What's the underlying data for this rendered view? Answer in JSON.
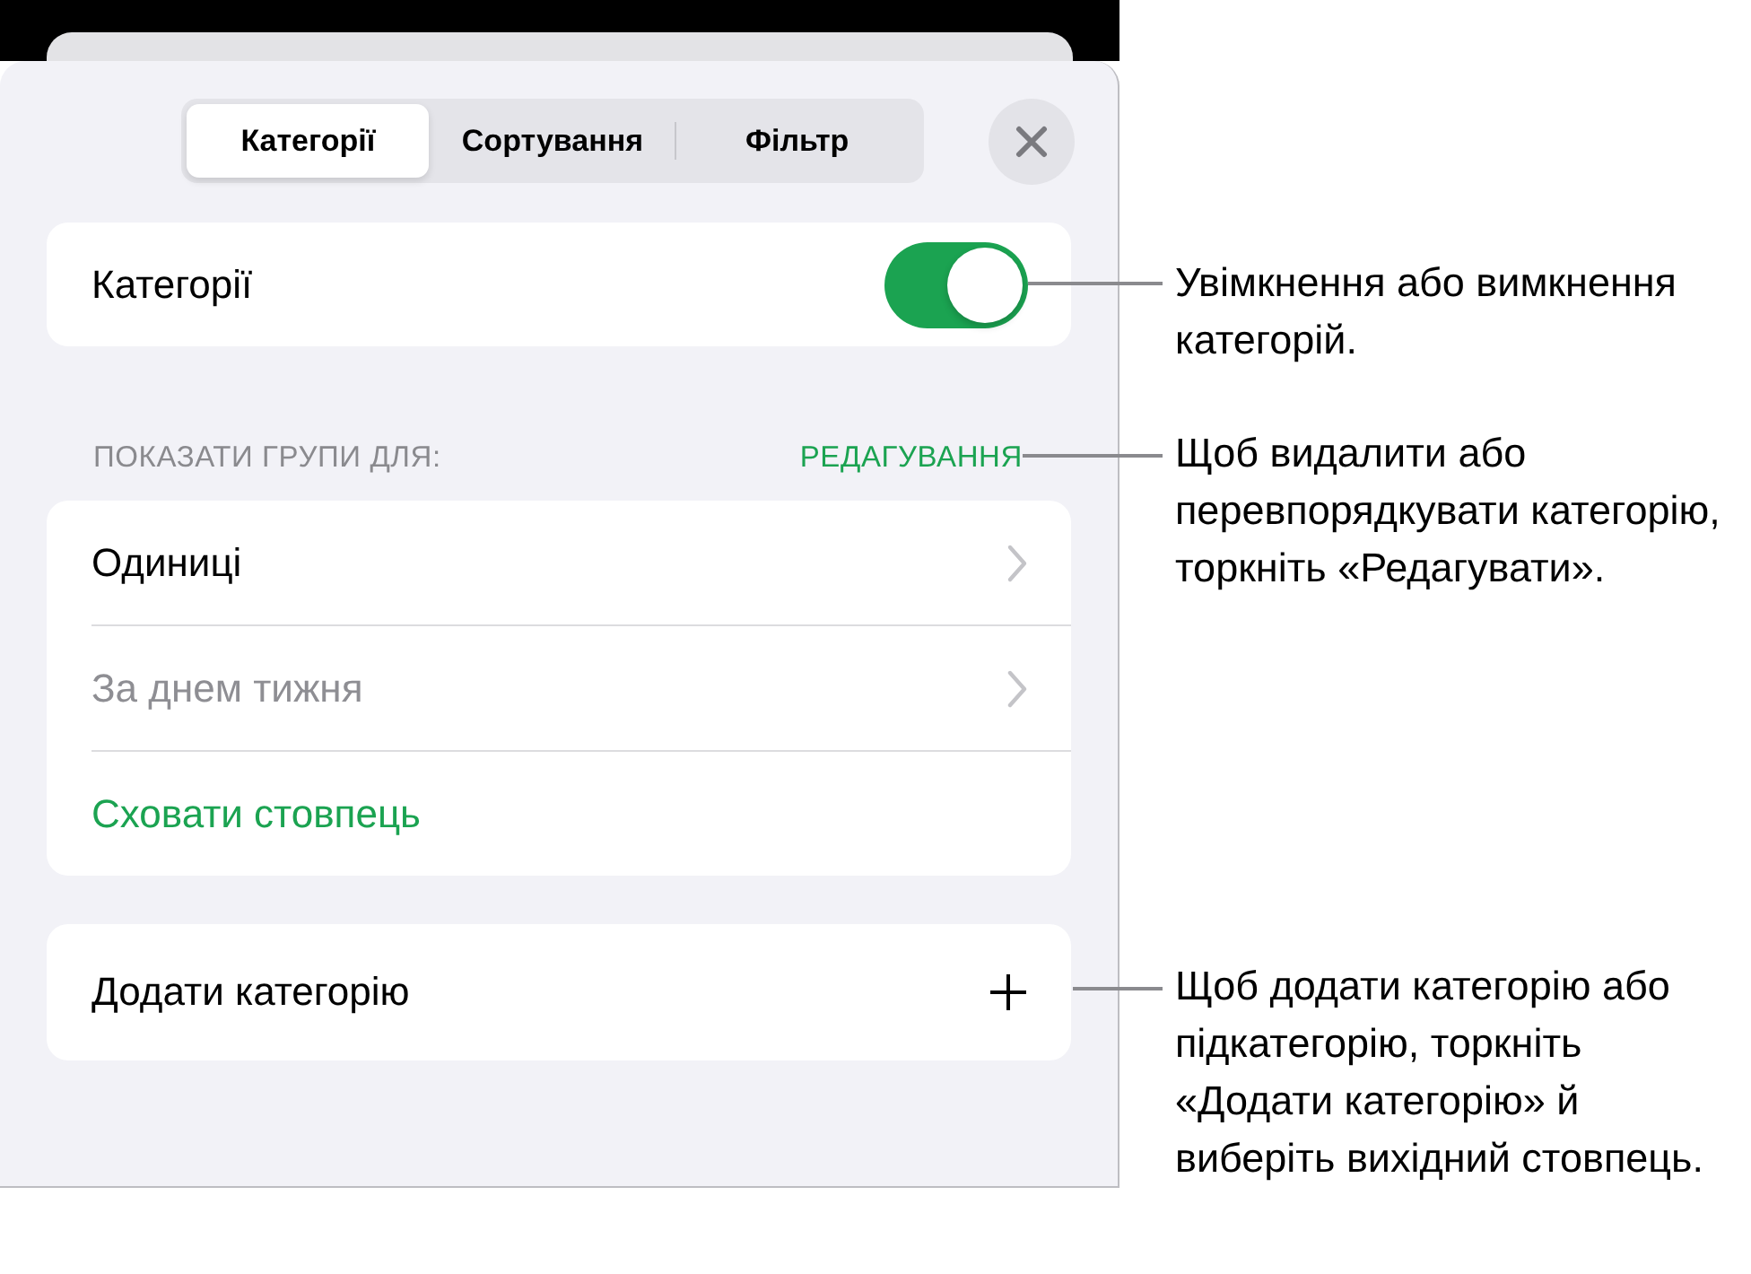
{
  "sheet": {
    "segments": [
      {
        "label": "Категорії",
        "selected": true
      },
      {
        "label": "Сортування",
        "selected": false
      },
      {
        "label": "Фільтр",
        "selected": false
      }
    ],
    "toggle_row": {
      "label": "Категорії",
      "on": true
    },
    "section": {
      "header": "ПОКАЗАТИ ГРУПИ ДЛЯ:",
      "action": "РЕДАГУВАННЯ"
    },
    "groups": [
      {
        "kind": "nav",
        "label": "Одиниці",
        "disabled": false
      },
      {
        "kind": "nav",
        "label": "За днем тижня",
        "disabled": true
      },
      {
        "kind": "action",
        "label": "Сховати стовпець"
      }
    ],
    "add_row": {
      "label": "Додати категорію"
    }
  },
  "callouts": [
    {
      "text": "Увімкнення або вимкнення категорій."
    },
    {
      "text": "Щоб видалити або перевпорядкувати категорію, торкніть «Редагувати»."
    },
    {
      "text": "Щоб додати категорію або підкатегорію, торкніть «Додати категорію» й виберіть вихідний стовпець."
    }
  ]
}
